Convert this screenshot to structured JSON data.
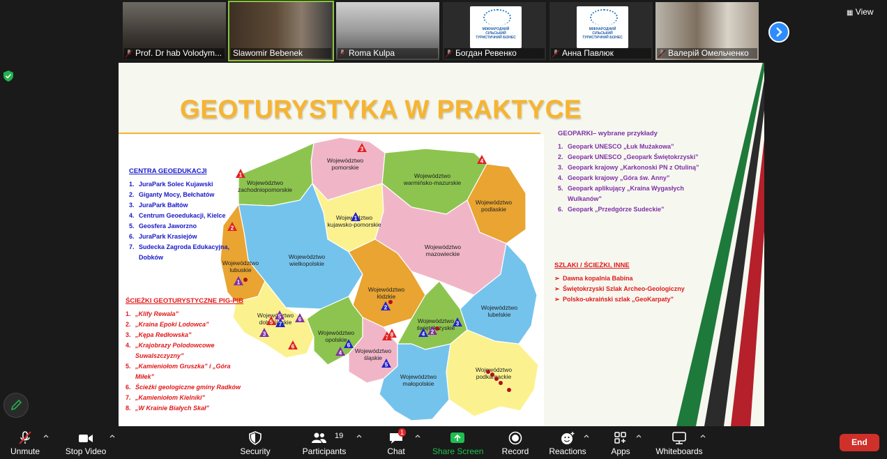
{
  "participants_strip": {
    "tiles": [
      {
        "name": "Prof. Dr hab Volodym...",
        "muted": true
      },
      {
        "name": "Slawomir Bebenek",
        "muted": false
      },
      {
        "name": "Roma Kulpa",
        "muted": true
      },
      {
        "name": "Богдан Ревенко",
        "muted": true
      },
      {
        "name": "Анна Павлюк",
        "muted": true
      },
      {
        "name": "Валерій Омельченко",
        "muted": true
      }
    ],
    "logo_text": "МІЖНАРОДНИЙ СІЛЬСЬКИЙ ТУРИСТИЧНИЙ БІЗНЕС"
  },
  "view_label": "View",
  "slide": {
    "title": "GEOTURYSTYKA W PRAKTYCE",
    "centra": {
      "heading": "CENTRA GEOEDUKACJI",
      "items": [
        {
          "n": "1.",
          "t": "JuraPark Solec Kujawski"
        },
        {
          "n": "2.",
          "t": "Giganty Mocy, Bełchatów"
        },
        {
          "n": "3.",
          "t": "JuraPark Bałtów"
        },
        {
          "n": "4.",
          "t": "Centrum Geoedukacji, Kielce"
        },
        {
          "n": "5.",
          "t": "Geosfera Jaworzno"
        },
        {
          "n": "6.",
          "t": "JuraPark Krasiejów"
        },
        {
          "n": "7.",
          "t": "Sudecka Zagroda Edukacyjna, Dobków"
        }
      ]
    },
    "sciezki": {
      "heading": "ŚCIEŻKI GEOTURYSTYCZNE PIG-PIB",
      "items": [
        {
          "n": "1.",
          "t": "„Klify Rewala”"
        },
        {
          "n": "2.",
          "t": "„Kraina Epoki Lodowca”"
        },
        {
          "n": "3.",
          "t": "„Kępa Redłowska”"
        },
        {
          "n": "4.",
          "t": "„Krajobrazy Polodowcowe Suwalszczyzny”"
        },
        {
          "n": "5.",
          "t": "„Kamieniołom Gruszka” i „Góra Miłek”"
        },
        {
          "n": "6.",
          "t": "Ścieżki geologiczne gminy Radków"
        },
        {
          "n": "7.",
          "t": "„Kamieniołom Kielniki”"
        },
        {
          "n": "8.",
          "t": "„W Krainie Białych Skał”"
        }
      ]
    },
    "geoparki": {
      "heading": "GEOPARKI– wybrane przykłady",
      "items": [
        {
          "n": "1.",
          "t": "Geopark UNESCO „Łuk Mużakowa”"
        },
        {
          "n": "2.",
          "t": "Geopark UNESCO „Geopark Świętokrzyski”"
        },
        {
          "n": "3.",
          "t": "Geopark krajowy „Karkonoski PN z Otuliną”"
        },
        {
          "n": "4.",
          "t": "Geopark krajowy „Góra św. Anny”"
        },
        {
          "n": "5.",
          "t": "Geopark aplikujący „Kraina Wygasłych Wulkanów”"
        },
        {
          "n": "6.",
          "t": "Geopark „Przedgórze Sudeckie”"
        }
      ]
    },
    "szlaki": {
      "heading": "SZLAKI / ŚCIEŻKI, INNE",
      "items": [
        {
          "t": "Dawna kopalnia Babina"
        },
        {
          "t": "Świętokrzyski Szlak Archeo-Geologiczny"
        },
        {
          "t": "Polsko-ukraiński szlak „GeoKarpaty”"
        }
      ]
    },
    "map": {
      "regions": [
        {
          "label1": "Województwo",
          "label2": "pomorskie",
          "color": "#f0b6c8"
        },
        {
          "label1": "Województwo",
          "label2": "warmińsko-mazurskie",
          "color": "#8dc44f"
        },
        {
          "label1": "Województwo",
          "label2": "zachodniopomorskie",
          "color": "#8dc44f"
        },
        {
          "label1": "Województwo",
          "label2": "podlaskie",
          "color": "#e9a431"
        },
        {
          "label1": "Województwo",
          "label2": "kujawsko-pomorskie",
          "color": "#fbf28f"
        },
        {
          "label1": "Województwo",
          "label2": "mazowieckie",
          "color": "#f0b6c8"
        },
        {
          "label1": "Województwo",
          "label2": "wielkopolskie",
          "color": "#74c3ec"
        },
        {
          "label1": "Województwo",
          "label2": "lubuskie",
          "color": "#e9a431"
        },
        {
          "label1": "Województwo",
          "label2": "łódzkie",
          "color": "#e9a431"
        },
        {
          "label1": "Województwo",
          "label2": "lubelskie",
          "color": "#74c3ec"
        },
        {
          "label1": "Województwo",
          "label2": "dolnośląskie",
          "color": "#fbf28f"
        },
        {
          "label1": "Województwo",
          "label2": "opolskie",
          "color": "#8dc44f"
        },
        {
          "label1": "Województwo",
          "label2": "śląskie",
          "color": "#f0b6c8"
        },
        {
          "label1": "Województwo",
          "label2": "świętokrzyskie",
          "color": "#8dc44f"
        },
        {
          "label1": "Województwo",
          "label2": "małopolskie",
          "color": "#74c3ec"
        },
        {
          "label1": "Województwo",
          "label2": "podkarpackie",
          "color": "#fbf28f"
        }
      ],
      "markers": {
        "red": [
          "1",
          "2",
          "3",
          "4",
          "5",
          "6",
          "7",
          "8"
        ],
        "blue": [
          "1",
          "2",
          "3",
          "4",
          "5",
          "6",
          "7"
        ],
        "purple": [
          "1",
          "2",
          "3",
          "4",
          "5",
          "6"
        ]
      }
    }
  },
  "toolbar": {
    "unmute": "Unmute",
    "stop_video": "Stop Video",
    "security": "Security",
    "participants": "Participants",
    "participants_count": "19",
    "chat": "Chat",
    "chat_badge": "1",
    "share_screen": "Share Screen",
    "record": "Record",
    "reactions": "Reactions",
    "apps": "Apps",
    "whiteboards": "Whiteboards",
    "end": "End"
  },
  "colors": {
    "accent_blue": "#2d8cff",
    "share_green": "#1fbf4f",
    "end_red": "#d0302a",
    "title_orange": "#f6b431"
  }
}
